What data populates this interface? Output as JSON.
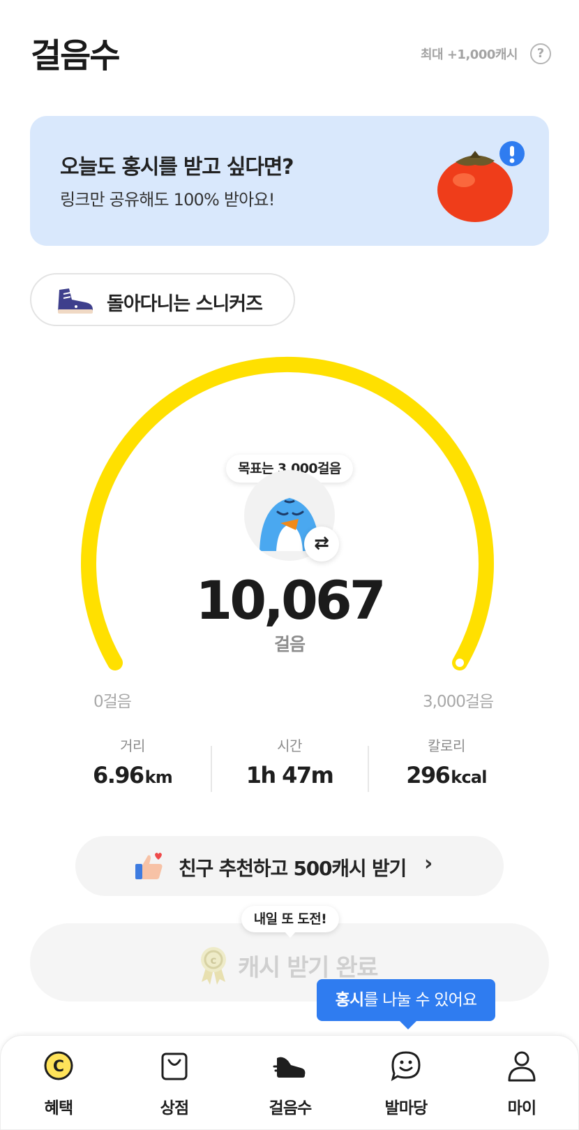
{
  "header": {
    "title": "걸음수",
    "max_cash": "최대 +1,000캐시",
    "help_icon": "?"
  },
  "banner": {
    "title": "오늘도 홍시를 받고 싶다면?",
    "subtitle": "링크만 공유해도 100% 받아요!",
    "image_icon": "persimmon-icon"
  },
  "shoe_chip": {
    "label": "돌아다니는 스니커즈",
    "icon": "sneaker-icon"
  },
  "gauge": {
    "goal_bubble": "목표는 3,000걸음",
    "steps": "10,067",
    "unit": "걸음",
    "min_label": "0걸음",
    "max_label": "3,000걸음",
    "progress": 1.0,
    "color": "#ffe000",
    "swap_symbol": "⇄"
  },
  "stats": [
    {
      "label": "거리",
      "value": "6.96",
      "unit": "km"
    },
    {
      "label": "시간",
      "value": "1h 47m",
      "unit": ""
    },
    {
      "label": "칼로리",
      "value": "296",
      "unit": "kcal"
    }
  ],
  "refer": {
    "label": "친구 추천하고 500캐시 받기",
    "chevron": "›"
  },
  "claim": {
    "bubble": "내일 또 도전!",
    "label": "캐시 받기 완료"
  },
  "tooltip": {
    "bold": "홍시",
    "text": "를 나눌 수 있어요",
    "color": "#2f7cf0"
  },
  "tabs": [
    {
      "label": "혜택",
      "icon": "cash-coin-icon"
    },
    {
      "label": "상점",
      "icon": "shopping-bag-icon"
    },
    {
      "label": "걸음수",
      "icon": "sneaker-icon",
      "active": true
    },
    {
      "label": "발마당",
      "icon": "chat-smile-icon"
    },
    {
      "label": "마이",
      "icon": "person-icon"
    }
  ]
}
